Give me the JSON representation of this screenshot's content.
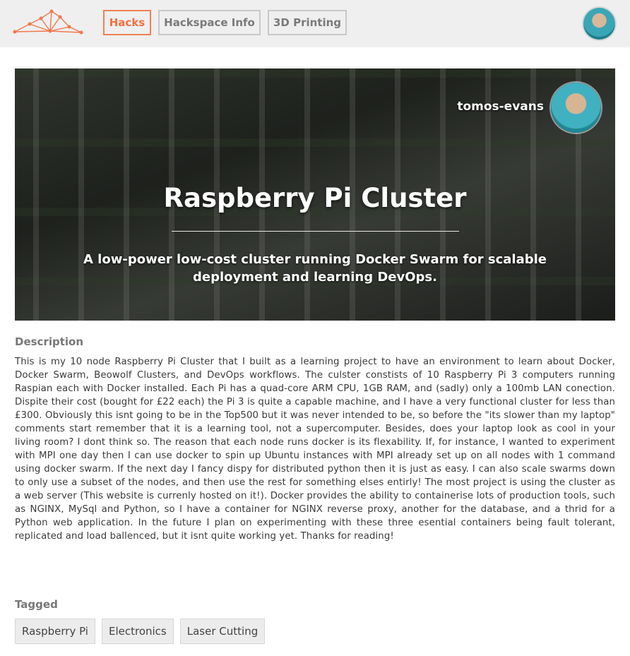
{
  "nav": {
    "logo_icon": "network-mesh-logo",
    "items": [
      {
        "label": "Hacks",
        "active": true
      },
      {
        "label": "Hackspace Info",
        "active": false
      },
      {
        "label": "3D Printing",
        "active": false
      }
    ],
    "avatar_icon": "user-avatar"
  },
  "hero": {
    "author": "tomos-evans",
    "title": "Raspberry Pi Cluster",
    "subtitle": "A low-power low-cost cluster running Docker Swarm for scalable deployment and learning DevOps."
  },
  "description": {
    "label": "Description",
    "text": "This is my 10 node Raspberry Pi Cluster that I built as a learning project to have an environment to learn about Docker, Docker Swarm, Beowolf Clusters, and DevOps workflows. The culster constists of 10 Raspberry Pi 3 computers running Raspian each with Docker installed. Each Pi has a quad-core ARM CPU, 1GB RAM, and (sadly) only a 100mb LAN conection. Dispite their cost (bought for £22 each) the Pi 3 is quite a capable machine, and I have a very functional cluster for less than £300. Obviously this isnt going to be in the Top500 but it was never intended to be, so before the \"its slower than my laptop\" comments start remember that it is a learning tool, not a supercomputer. Besides, does your laptop look as cool in your living room? I dont think so. The reason that each node runs docker is its flexability. If, for instance, I wanted to experiment with MPI one day then I can use docker to spin up Ubuntu instances with MPI already set up on all nodes with 1 command using docker swarm. If the next day I fancy dispy for distributed python then it is just as easy. I can also scale swarms down to only use a subset of the nodes, and then use the rest for something elses entirly! The most project is using the cluster as a web server (This website is currenly hosted on it!). Docker provides the ability to containerise lots of production tools, such as NGINX, MySql and Python, so I have a container for NGINX reverse proxy, another for the database, and a thrid for a Python web application. In the future I plan on experimenting with these three esential containers being fault tolerant, replicated and load ballenced, but it isnt quite working yet. Thanks for reading!"
  },
  "tagged": {
    "label": "Tagged",
    "tags": [
      "Raspberry Pi",
      "Electronics",
      "Laser Cutting"
    ]
  },
  "colors": {
    "accent": "#f07040",
    "topbar_bg": "#efefef"
  }
}
